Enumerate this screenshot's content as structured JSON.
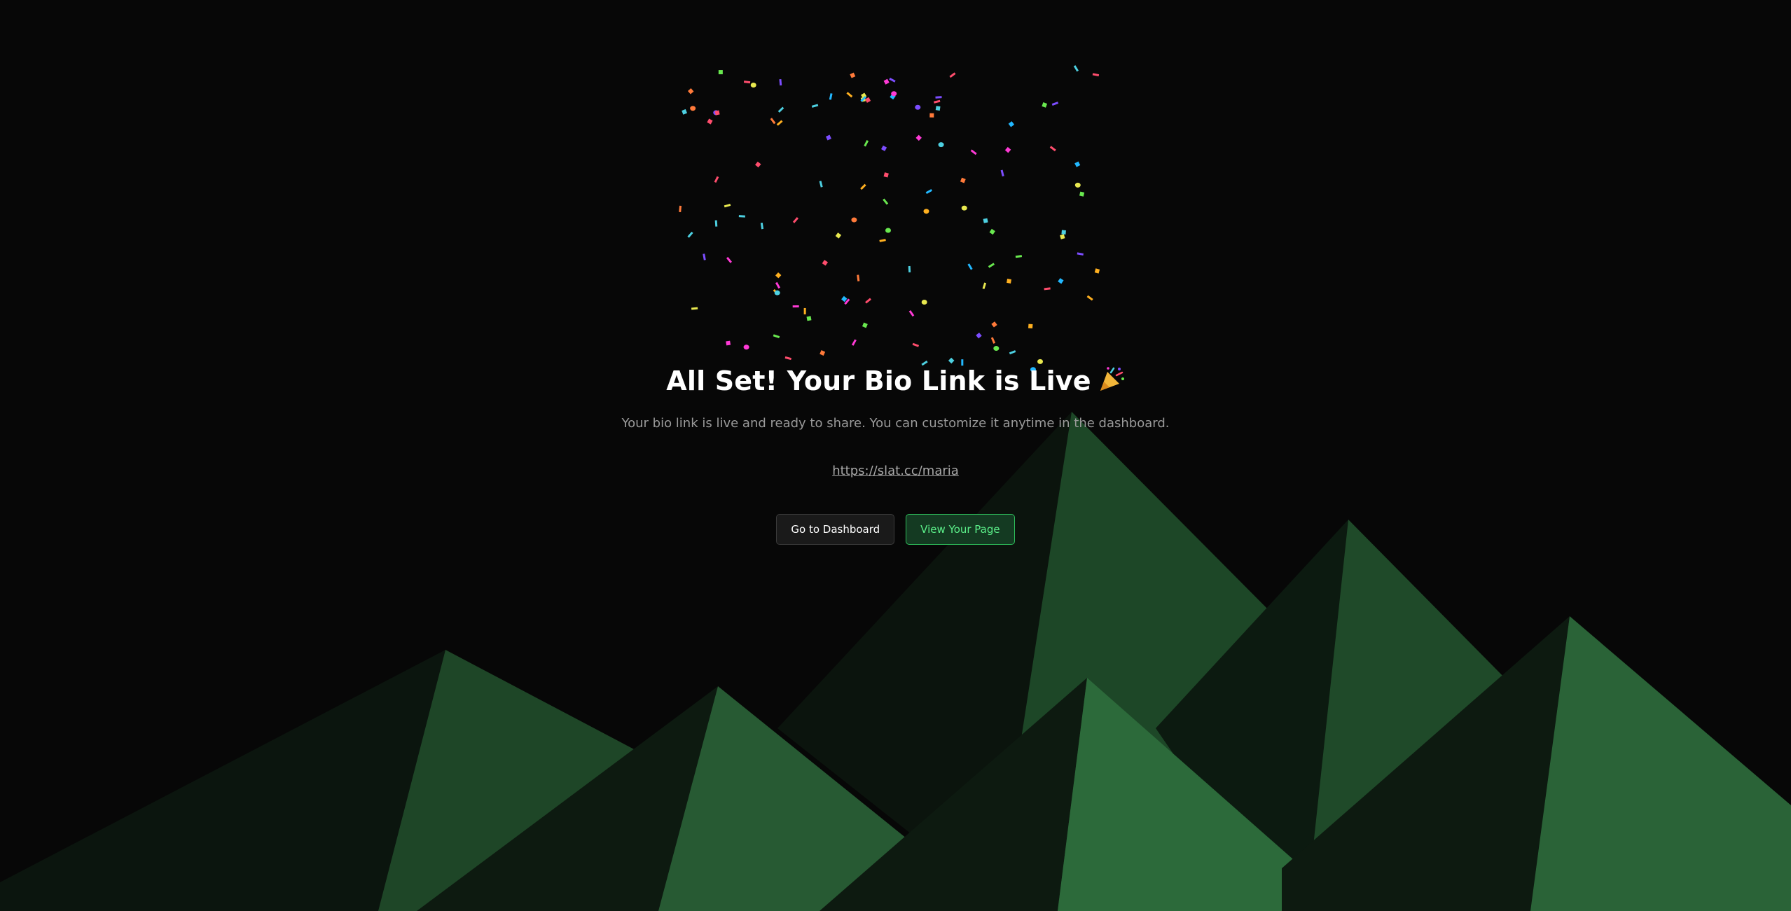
{
  "success": {
    "title": "All Set! Your Bio Link is Live",
    "emoji": "🎉",
    "subtitle": "Your bio link is live and ready to share. You can customize it anytime in the dashboard.",
    "url": "https://slat.cc/maria"
  },
  "actions": {
    "dashboard_label": "Go to Dashboard",
    "view_label": "View Your Page"
  },
  "theme": {
    "background": "#070707",
    "accent": "#2ebd5a",
    "mountain_light": "#2d6a3a",
    "mountain_mid": "#1e4a28",
    "mountain_dark": "#0c1a10"
  },
  "confetti_colors": [
    "#ff4d6d",
    "#ffb020",
    "#4dd0e1",
    "#7c4dff",
    "#69e84f",
    "#ff3ad6",
    "#ff7a3a",
    "#22b8ff",
    "#e8e84f"
  ]
}
